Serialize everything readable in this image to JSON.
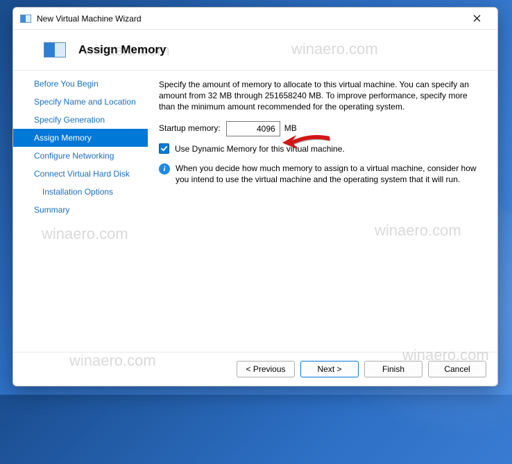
{
  "window": {
    "title": "New Virtual Machine Wizard"
  },
  "header": {
    "title": "Assign Memory"
  },
  "sidebar": {
    "steps": [
      {
        "label": "Before You Begin"
      },
      {
        "label": "Specify Name and Location"
      },
      {
        "label": "Specify Generation"
      },
      {
        "label": "Assign Memory"
      },
      {
        "label": "Configure Networking"
      },
      {
        "label": "Connect Virtual Hard Disk"
      },
      {
        "label": "Installation Options"
      },
      {
        "label": "Summary"
      }
    ],
    "active_index": 3,
    "indent_index": 6
  },
  "content": {
    "description": "Specify the amount of memory to allocate to this virtual machine. You can specify an amount from 32 MB through 251658240 MB. To improve performance, specify more than the minimum amount recommended for the operating system.",
    "startup_label": "Startup memory:",
    "startup_value": "4096",
    "startup_unit": "MB",
    "dynamic_label": "Use Dynamic Memory for this virtual machine.",
    "dynamic_checked": true,
    "info_text": "When you decide how much memory to assign to a virtual machine, consider how you intend to use the virtual machine and the operating system that it will run."
  },
  "footer": {
    "previous": "< Previous",
    "next": "Next >",
    "finish": "Finish",
    "cancel": "Cancel"
  },
  "watermark": "winaero.com"
}
